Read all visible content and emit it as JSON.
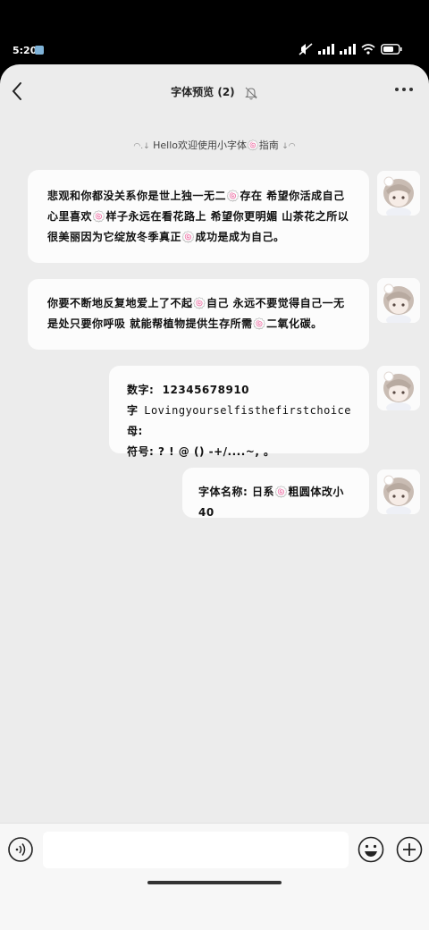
{
  "status_bar": {
    "time": "5:20"
  },
  "header": {
    "title": "字体预览 (2)"
  },
  "system_message": {
    "text": "Hello欢迎使用小字体🍥指南"
  },
  "messages": {
    "m1": "悲观和你都没关系你是世上独一无二🍥存在  希望你活成自己心里喜欢🍥样子永远在看花路上  希望你更明媚  山茶花之所以很美丽因为它绽放冬季真正🍥成功是成为自己。",
    "m2": "你要不断地反复地爱上了不起🍥自己  永远不要觉得自己一无是处只要你呼吸  就能帮植物提供生存所需🍥二氧化碳。",
    "m3": {
      "digits_label": "数字:",
      "digits_value": "12345678910",
      "letters_label": "字母:",
      "letters_words": [
        "Loving",
        "yourself",
        "is",
        "the",
        "first",
        "choice"
      ],
      "symbols_label": "符号:",
      "symbols_value": "? ! @ () -+/....~, 。"
    },
    "m4": "字体名称: 日系🍥粗圆体改小40"
  },
  "input": {
    "placeholder": ""
  },
  "icons": {
    "back": "chevron-left-icon",
    "mute": "bell-off-icon",
    "more": "more-horizontal-icon",
    "voice": "voice-icon",
    "emoji": "emoji-icon",
    "plus": "plus-icon"
  },
  "colors": {
    "background": "#ececec",
    "bubble": "#fcfcfc",
    "text": "#111111"
  }
}
